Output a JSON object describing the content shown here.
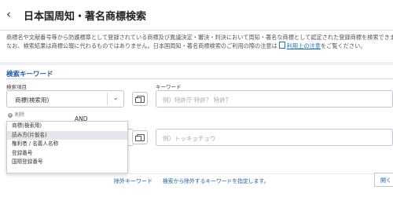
{
  "header": {
    "title": "日本国周知・著名商標検索",
    "back_icon": "chevron-left-icon"
  },
  "description": {
    "line1": "商標名や文献番号等から防護標章として登録されている商標及び異議決定・審決・判決において周知・著名な商標として認定された登録商標を検索できます。",
    "line2_pre": "なお、検索結果は商標公報に代わるものではありません。日本国周知・著名商標検索のご利用の際の注意は",
    "line2_link": "利用上の注意",
    "line2_post": "をご覧ください。"
  },
  "search": {
    "section_title": "検索キーワード",
    "item_label": "検索項目",
    "keyword_label": "キーワード",
    "row1": {
      "selected": "商標(検索用)",
      "placeholder": "例）特許庁 特許？ 特許？"
    },
    "delete_label": "削除",
    "and_label": "AND",
    "row2": {
      "placeholder": "例）トッキョチョウ"
    },
    "dropdown_options": [
      "商標(検索用)",
      "読み方(片仮名)",
      "権利者 / 名義人名称",
      "登録番号",
      "国際登録番号"
    ],
    "selected_option_index": 1,
    "exclude_label": "除外キーワード",
    "exclude_placeholder": "検索から除外するキーワードを指定します。",
    "open_label": "開く"
  }
}
